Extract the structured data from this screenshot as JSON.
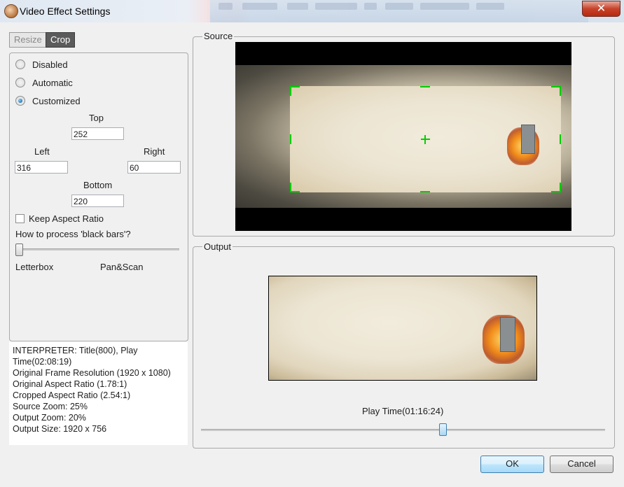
{
  "window": {
    "title": "Video Effect Settings",
    "close_glyph": "✕"
  },
  "tabs": [
    {
      "label": "Resize"
    },
    {
      "label": "Crop"
    }
  ],
  "crop": {
    "modes": [
      {
        "label": "Disabled",
        "selected": false
      },
      {
        "label": "Automatic",
        "selected": false
      },
      {
        "label": "Customized",
        "selected": true
      }
    ],
    "top_label": "Top",
    "top_value": "252",
    "left_label": "Left",
    "left_value": "316",
    "right_label": "Right",
    "right_value": "60",
    "bottom_label": "Bottom",
    "bottom_value": "220",
    "keep_aspect_label": "Keep Aspect Ratio",
    "keep_aspect_checked": false,
    "black_bars_question": "How to process 'black bars'?",
    "black_bars_slider_level": 0,
    "slider_left_label": "Letterbox",
    "slider_right_label": "Pan&Scan"
  },
  "info_lines": [
    "INTERPRETER: Title(800), Play",
    "Time(02:08:19)",
    "Original Frame Resolution  (1920 x 1080)",
    "Original Aspect Ratio (1.78:1)",
    "Cropped Aspect Ratio (2.54:1)",
    "Source Zoom:  25%",
    "Output Zoom:  20%",
    "Output Size:  1920 x 756"
  ],
  "source": {
    "label": "Source"
  },
  "output": {
    "label": "Output"
  },
  "playback": {
    "label": "Play Time(01:16:24)",
    "position_fraction": 0.6
  },
  "buttons": {
    "ok": "OK",
    "cancel": "Cancel"
  },
  "colors": {
    "crop_marker": "#00d000",
    "ok_border": "#3c7fb1"
  }
}
